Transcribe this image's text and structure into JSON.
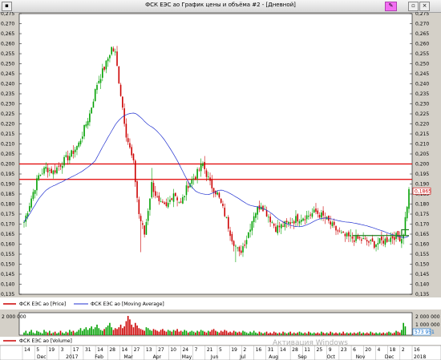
{
  "window": {
    "title": "ФСК ЕЭС ао График цены и объёма #2 - [Дневной]"
  },
  "chart_data": {
    "type": "candlestick",
    "price_axis": {
      "min": 0.135,
      "max": 0.275,
      "ticks": [
        "0,135",
        "0,140",
        "0,145",
        "0,150",
        "0,155",
        "0,160",
        "0,165",
        "0,170",
        "0,175",
        "0,180",
        "0,185",
        "0,190",
        "0,195",
        "0,200",
        "0,205",
        "0,210",
        "0,215",
        "0,220",
        "0,225",
        "0,230",
        "0,235",
        "0,240",
        "0,245",
        "0,250",
        "0,255",
        "0,260",
        "0,265",
        "0,270",
        "0,275"
      ]
    },
    "horizontal_lines": [
      0.2,
      0.1923
    ],
    "support_line": {
      "value": 0.1643,
      "from_index": 180
    },
    "last_price": {
      "value": 0.1865,
      "label": "0,1865"
    },
    "anchors": [
      [
        0,
        0.171
      ],
      [
        5,
        0.186
      ],
      [
        8,
        0.194
      ],
      [
        12,
        0.198
      ],
      [
        16,
        0.196
      ],
      [
        20,
        0.2
      ],
      [
        26,
        0.205
      ],
      [
        30,
        0.21
      ],
      [
        36,
        0.225
      ],
      [
        40,
        0.24
      ],
      [
        45,
        0.25
      ],
      [
        48,
        0.258
      ],
      [
        50,
        0.255
      ],
      [
        53,
        0.235
      ],
      [
        56,
        0.215
      ],
      [
        60,
        0.2
      ],
      [
        63,
        0.175
      ],
      [
        66,
        0.165
      ],
      [
        70,
        0.19
      ],
      [
        74,
        0.18
      ],
      [
        78,
        0.178
      ],
      [
        82,
        0.186
      ],
      [
        86,
        0.18
      ],
      [
        90,
        0.19
      ],
      [
        94,
        0.194
      ],
      [
        98,
        0.2
      ],
      [
        102,
        0.19
      ],
      [
        106,
        0.185
      ],
      [
        110,
        0.175
      ],
      [
        114,
        0.163
      ],
      [
        118,
        0.155
      ],
      [
        122,
        0.163
      ],
      [
        126,
        0.175
      ],
      [
        130,
        0.18
      ],
      [
        134,
        0.174
      ],
      [
        138,
        0.168
      ],
      [
        144,
        0.17
      ],
      [
        150,
        0.173
      ],
      [
        155,
        0.174
      ],
      [
        160,
        0.176
      ],
      [
        165,
        0.173
      ],
      [
        170,
        0.168
      ],
      [
        175,
        0.164
      ],
      [
        180,
        0.163
      ],
      [
        186,
        0.162
      ],
      [
        192,
        0.16
      ],
      [
        198,
        0.162
      ],
      [
        203,
        0.164
      ],
      [
        207,
        0.163
      ],
      [
        208,
        0.166
      ],
      [
        211,
        0.1865
      ]
    ],
    "spikes": {
      "64": 0.156,
      "60": 0.205,
      "70": 0.198,
      "116": 0.151
    },
    "moving_average": {
      "name": "ФСК ЕЭС ао [Moving Average]"
    },
    "price_series": {
      "name": "ФСК ЕЭС ао [Price]"
    },
    "volume": {
      "name": "ФСК ЕЭС ао [Volume]",
      "axis_ticks": [
        "1 000 000",
        "2 000 000"
      ],
      "last_label": "573 951",
      "bars": [
        3,
        5,
        2,
        4,
        6,
        3,
        2,
        5,
        4,
        3,
        2,
        6,
        4,
        3,
        5,
        2,
        3,
        4,
        2,
        3,
        5,
        3,
        2,
        4,
        3,
        6,
        4,
        5,
        3,
        4,
        6,
        8,
        5,
        7,
        9,
        6,
        8,
        10,
        7,
        9,
        12,
        8,
        6,
        5,
        7,
        9,
        11,
        14,
        9,
        6,
        8,
        7,
        9,
        12,
        8,
        10,
        16,
        22,
        18,
        12,
        9,
        14,
        11,
        8,
        7,
        6,
        5,
        9,
        8,
        6,
        5,
        7,
        6,
        5,
        4,
        6,
        7,
        5,
        4,
        6,
        5,
        4,
        6,
        5,
        7,
        4,
        5,
        4,
        6,
        5,
        3,
        4,
        5,
        4,
        3,
        5,
        4,
        6,
        5,
        4,
        3,
        5,
        4,
        6,
        7,
        5,
        4,
        3,
        5,
        4,
        6,
        5,
        3,
        4,
        3,
        5,
        4,
        3,
        4,
        3,
        5,
        4,
        3,
        2,
        4,
        3,
        5,
        3,
        2,
        4,
        3,
        2,
        3,
        4,
        2,
        3,
        2,
        4,
        3,
        2,
        3,
        2,
        4,
        3,
        2,
        3,
        4,
        2,
        3,
        2,
        3,
        4,
        3,
        2,
        3,
        2,
        4,
        3,
        2,
        3,
        2,
        3,
        2,
        4,
        3,
        2,
        3,
        2,
        4,
        3,
        2,
        3,
        2,
        3,
        2,
        4,
        2,
        3,
        2,
        3,
        2,
        3,
        2,
        3,
        4,
        2,
        3,
        2,
        3,
        2,
        4,
        3,
        2,
        3,
        2,
        3,
        2,
        3,
        2,
        3,
        4,
        3,
        2,
        3,
        5,
        4,
        3,
        6,
        14,
        10
      ]
    },
    "date_axis": {
      "row1": [
        "14",
        "5",
        "19",
        "3",
        "17",
        "31",
        "14",
        "28",
        "14",
        "27",
        "13",
        "27",
        "10",
        "24",
        "7",
        "21",
        "5",
        "19",
        "2",
        "16",
        "31",
        "14",
        "28",
        "11",
        "25",
        "9",
        "23",
        "6",
        "20",
        "4",
        "18",
        "2",
        "16"
      ],
      "row2": [
        "Dec",
        "2017",
        "Feb",
        "Mar",
        "Apr",
        "May",
        "Jun",
        "Jul",
        "Aug",
        "Sep",
        "Oct",
        "Nov",
        "Dec",
        "2018"
      ]
    },
    "watermark": "Активация Windows",
    "colors": {
      "up": "#00a000",
      "down": "#cc0000",
      "ma": "#2030d0",
      "hline": "#e00000",
      "support": "#208020"
    }
  }
}
